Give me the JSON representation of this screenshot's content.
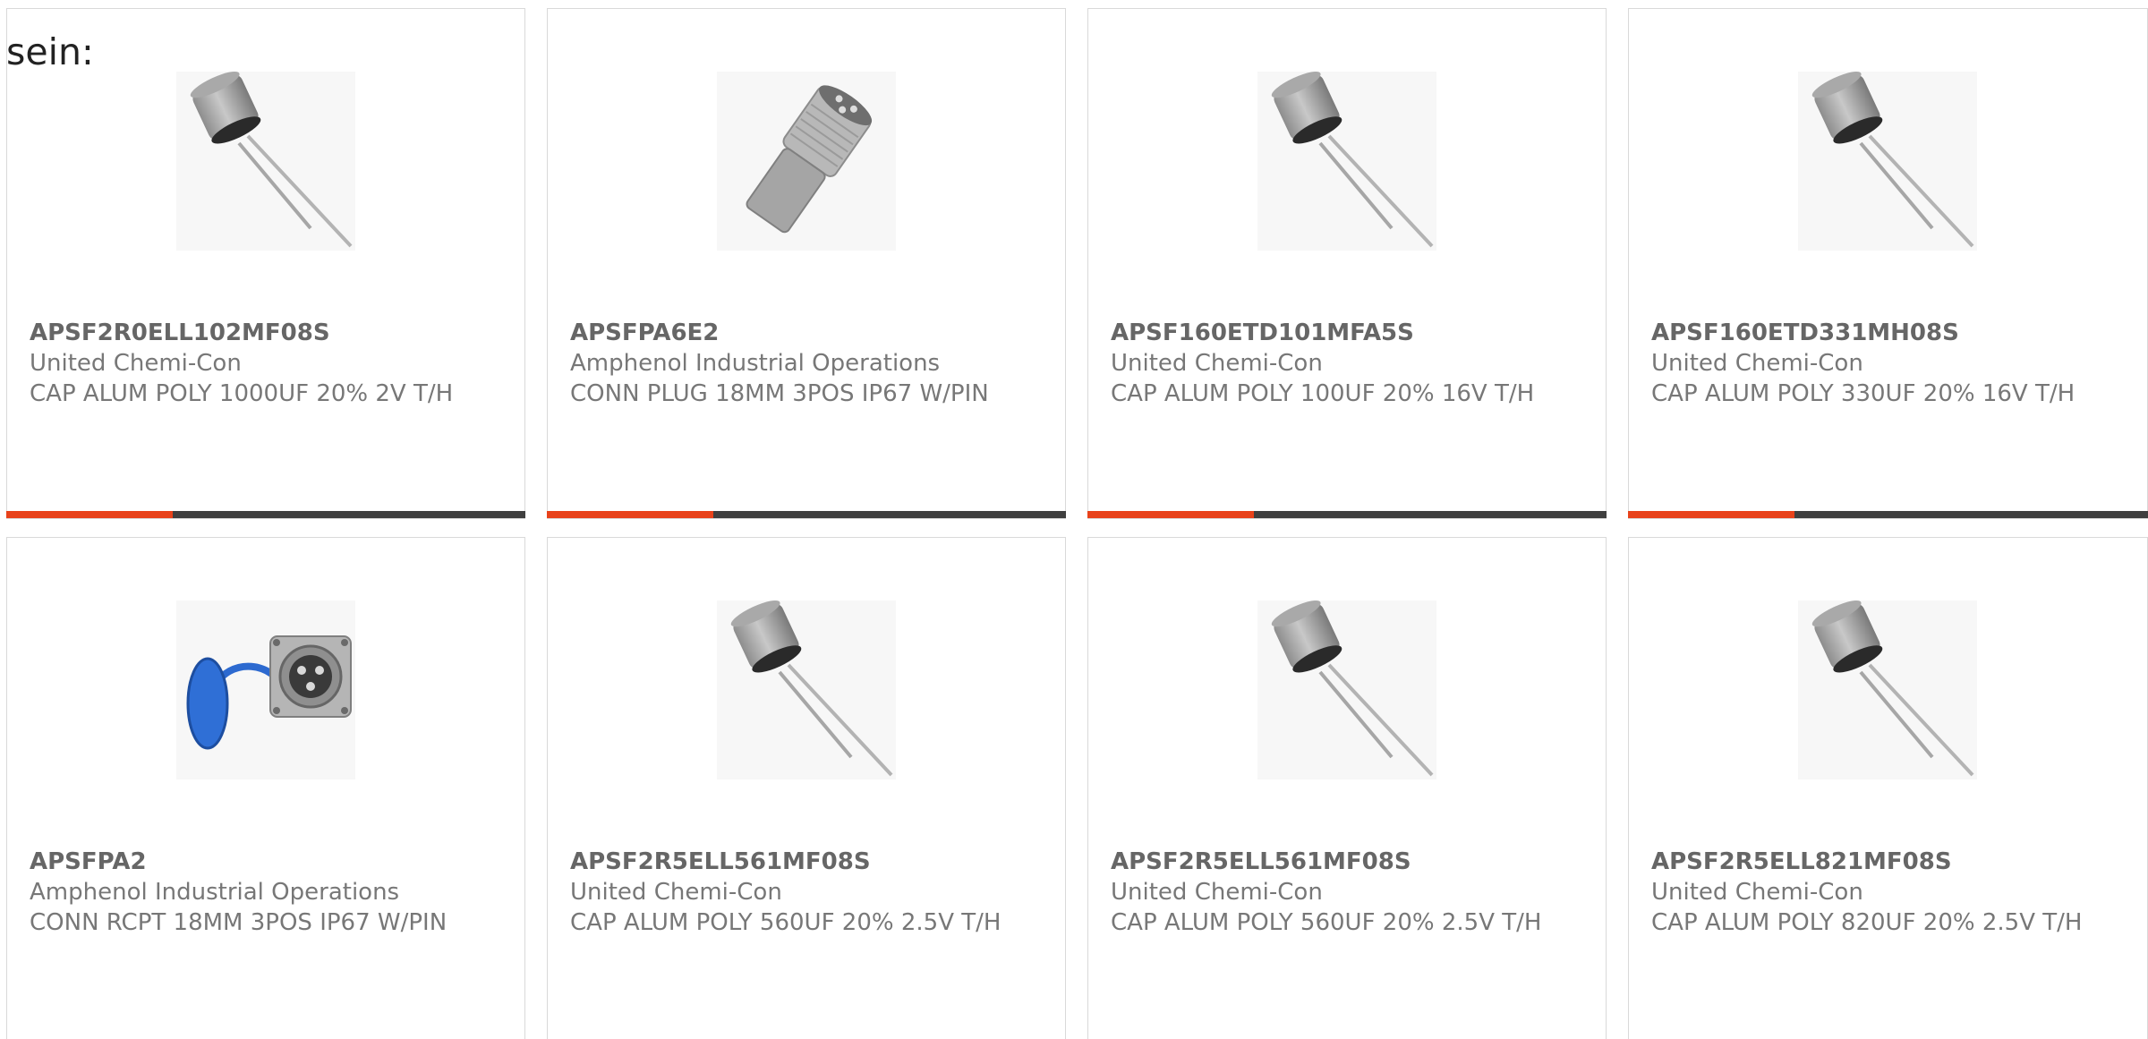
{
  "lead_text": "sein:",
  "colors": {
    "accent": "#e8421a",
    "bar": "#3f3f3f",
    "border": "#d9d9d9",
    "text": "#777777"
  },
  "products": [
    {
      "part_number": "APSF2R0ELL102MF08S",
      "manufacturer": "United Chemi-Con",
      "description": "CAP ALUM POLY 1000UF 20% 2V T/H",
      "image_icon": "capacitor-icon",
      "progress": 0.32
    },
    {
      "part_number": "APSFPA6E2",
      "manufacturer": "Amphenol Industrial Operations",
      "description": "CONN PLUG 18MM 3POS IP67 W/PIN",
      "image_icon": "connector-plug-icon",
      "progress": 0.32
    },
    {
      "part_number": "APSF160ETD101MFA5S",
      "manufacturer": "United Chemi-Con",
      "description": "CAP ALUM POLY 100UF 20% 16V T/H",
      "image_icon": "capacitor-icon",
      "progress": 0.32
    },
    {
      "part_number": "APSF160ETD331MH08S",
      "manufacturer": "United Chemi-Con",
      "description": "CAP ALUM POLY 330UF 20% 16V T/H",
      "image_icon": "capacitor-icon",
      "progress": 0.32
    },
    {
      "part_number": "APSFPA2",
      "manufacturer": "Amphenol Industrial Operations",
      "description": "CONN RCPT 18MM 3POS IP67 W/PIN",
      "image_icon": "connector-receptacle-icon"
    },
    {
      "part_number": "APSF2R5ELL561MF08S",
      "manufacturer": "United Chemi-Con",
      "description": "CAP ALUM POLY 560UF 20% 2.5V T/H",
      "image_icon": "capacitor-icon"
    },
    {
      "part_number": "APSF2R5ELL561MF08S",
      "manufacturer": "United Chemi-Con",
      "description": "CAP ALUM POLY 560UF 20% 2.5V T/H",
      "image_icon": "capacitor-icon"
    },
    {
      "part_number": "APSF2R5ELL821MF08S",
      "manufacturer": "United Chemi-Con",
      "description": "CAP ALUM POLY 820UF 20% 2.5V T/H",
      "image_icon": "capacitor-icon"
    }
  ]
}
